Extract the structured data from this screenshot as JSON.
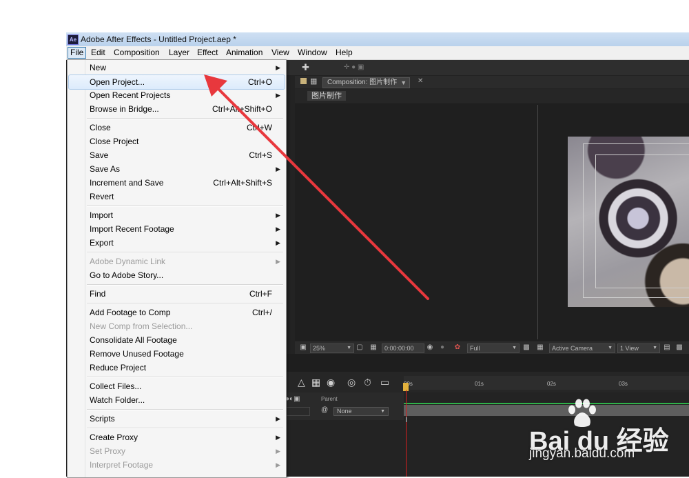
{
  "window": {
    "title": "Adobe After Effects - Untitled Project.aep *",
    "icon_label": "Ae"
  },
  "menubar": {
    "items": [
      "File",
      "Edit",
      "Composition",
      "Layer",
      "Effect",
      "Animation",
      "View",
      "Window",
      "Help"
    ],
    "active": "File"
  },
  "file_menu": {
    "groups": [
      [
        {
          "label": "New",
          "submenu": true
        },
        {
          "label": "Open Project...",
          "shortcut": "Ctrl+O",
          "highlighted": true
        },
        {
          "label": "Open Recent Projects",
          "submenu": true
        },
        {
          "label": "Browse in Bridge...",
          "shortcut": "Ctrl+Alt+Shift+O"
        }
      ],
      [
        {
          "label": "Close",
          "shortcut": "Ctrl+W"
        },
        {
          "label": "Close Project"
        },
        {
          "label": "Save",
          "shortcut": "Ctrl+S"
        },
        {
          "label": "Save As",
          "submenu": true
        },
        {
          "label": "Increment and Save",
          "shortcut": "Ctrl+Alt+Shift+S"
        },
        {
          "label": "Revert"
        }
      ],
      [
        {
          "label": "Import",
          "submenu": true
        },
        {
          "label": "Import Recent Footage",
          "submenu": true
        },
        {
          "label": "Export",
          "submenu": true
        }
      ],
      [
        {
          "label": "Adobe Dynamic Link",
          "submenu": true,
          "disabled": true
        },
        {
          "label": "Go to Adobe Story..."
        }
      ],
      [
        {
          "label": "Find",
          "shortcut": "Ctrl+F"
        }
      ],
      [
        {
          "label": "Add Footage to Comp",
          "shortcut": "Ctrl+/"
        },
        {
          "label": "New Comp from Selection...",
          "disabled": true
        },
        {
          "label": "Consolidate All Footage"
        },
        {
          "label": "Remove Unused Footage"
        },
        {
          "label": "Reduce Project"
        }
      ],
      [
        {
          "label": "Collect Files..."
        },
        {
          "label": "Watch Folder..."
        }
      ],
      [
        {
          "label": "Scripts",
          "submenu": true
        }
      ],
      [
        {
          "label": "Create Proxy",
          "submenu": true
        },
        {
          "label": "Set Proxy",
          "submenu": true,
          "disabled": true
        },
        {
          "label": "Interpret Footage",
          "submenu": true,
          "disabled": true
        }
      ]
    ]
  },
  "composition_panel": {
    "tab_label": "Composition: 图片制作",
    "breadcrumb": "图片制作"
  },
  "viewer_controls": {
    "zoom": "25%",
    "timecode": "0:00:00:00",
    "resolution": "Full",
    "camera": "Active Camera",
    "views": "1 View"
  },
  "timeline": {
    "ruler_ticks": [
      "00s",
      "01s",
      "02s",
      "03s"
    ],
    "parent_header": "Parent",
    "parent_value": "None"
  },
  "watermark": {
    "brand": "Bai du 经验",
    "url": "jingyan.baidu.com"
  },
  "colors": {
    "annotation_arrow": "#e8383d",
    "menu_highlight": "#dcebfc",
    "app_background": "#232323",
    "track_green": "#2fb24a",
    "playhead": "#d82020"
  }
}
